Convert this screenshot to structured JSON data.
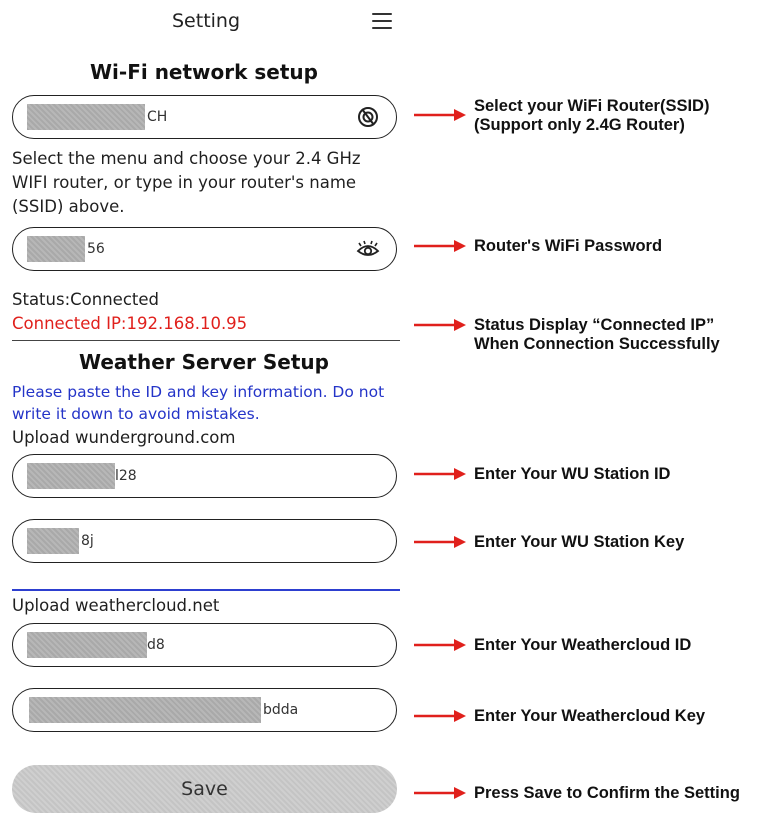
{
  "header": {
    "title": "Setting",
    "menu_icon": "hamburger-menu-icon"
  },
  "wifi": {
    "title": "Wi-Fi network setup",
    "ssid_value_suffix": "CH",
    "ssid_icon": "router-scan-icon",
    "help_line_1": "Select the menu and choose your 2.4 GHz",
    "help_line_2": "WIFI router, or type in your router's name",
    "help_line_3": "(SSID) above.",
    "password_value_suffix": "56",
    "password_icon": "eye-icon",
    "status": "Status:Connected",
    "connected_ip": "Connected IP:192.168.10.95"
  },
  "weather": {
    "title": "Weather Server Setup",
    "note_line_1": "Please paste the ID and key information. Do not",
    "note_line_2": "write it down to avoid mistakes.",
    "wu_label": "Upload wunderground.com",
    "wu_id_suffix": "l28",
    "wu_key_suffix": "8j",
    "wc_label": "Upload weathercloud.net",
    "wc_id_suffix": "d8",
    "wc_key_suffix": "bdda"
  },
  "save": {
    "label": "Save"
  },
  "annotations": {
    "ssid_1": "Select your WiFi Router(SSID)",
    "ssid_2": "(Support only 2.4G Router)",
    "password": "Router's WiFi Password",
    "status_1": "Status Display “Connected IP”",
    "status_2": "When Connection Successfully",
    "wu_id": "Enter Your WU Station ID",
    "wu_key": "Enter Your WU Station Key",
    "wc_id": "Enter Your Weathercloud ID",
    "wc_key": "Enter Your Weathercloud Key",
    "save": "Press Save to Confirm the Setting"
  },
  "colors": {
    "accent_red": "#e0201c",
    "accent_blue": "#2434c8"
  }
}
